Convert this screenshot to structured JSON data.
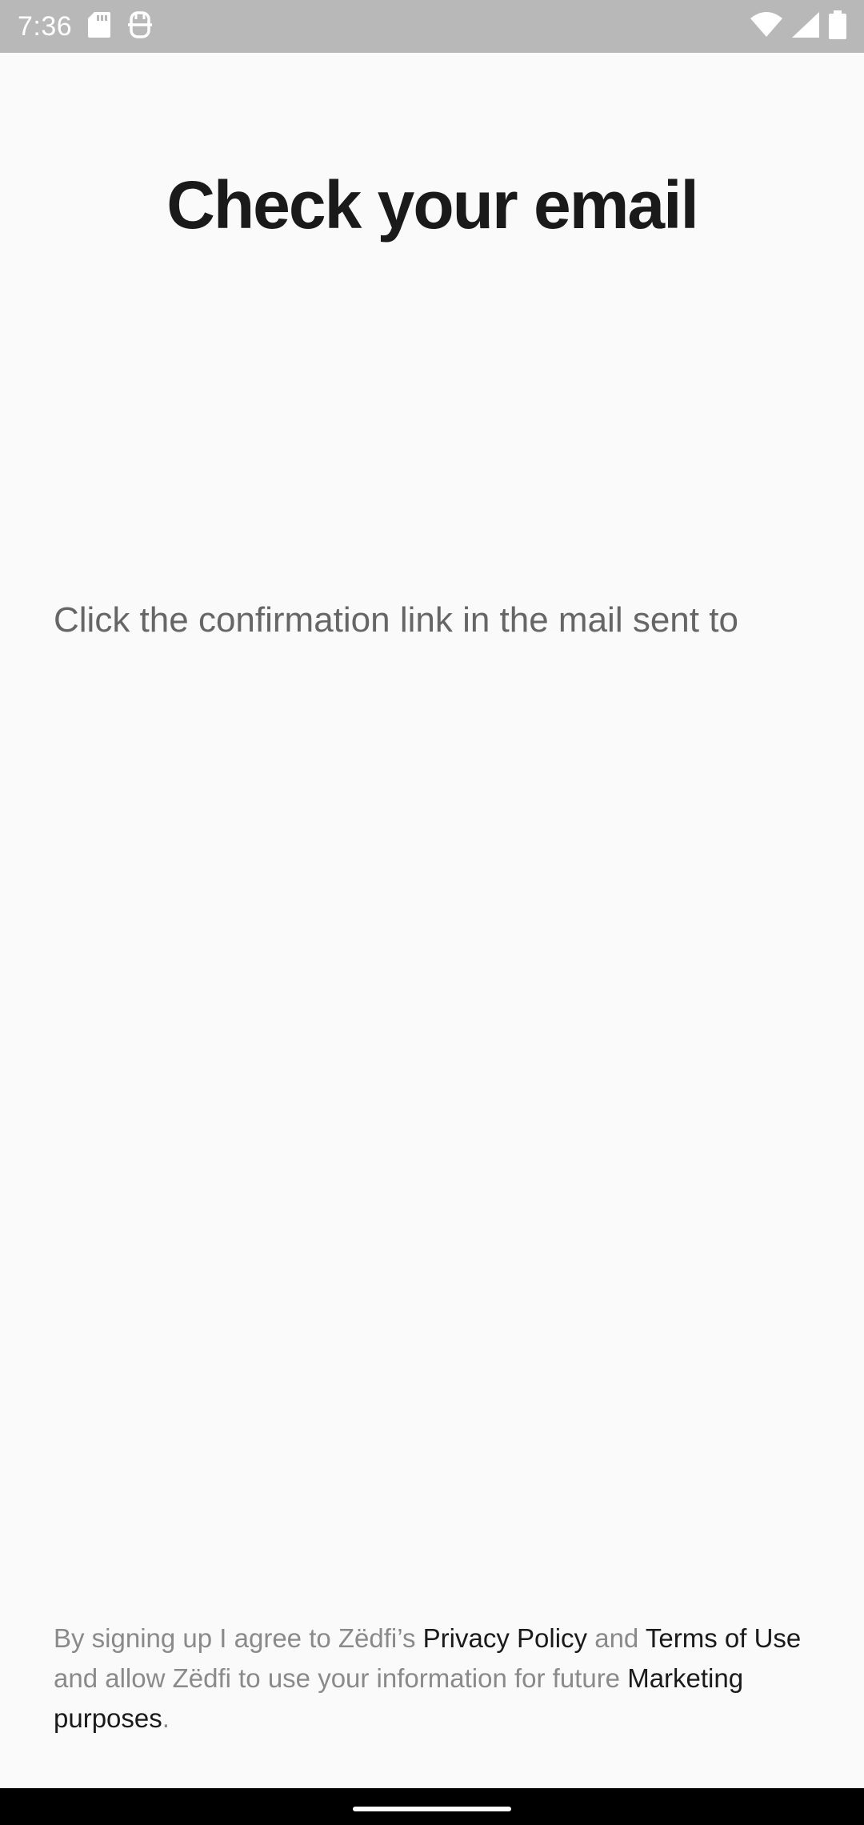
{
  "status_bar": {
    "time": "7:36",
    "left_icons": [
      "sd-card-icon",
      "assistant-icon"
    ],
    "right_icons": [
      "wifi-icon",
      "cellular-signal-icon",
      "battery-icon"
    ],
    "background_color": "#b8b8b8"
  },
  "header": {
    "title": "Check your email"
  },
  "main": {
    "message": "Click the confirmation link in the mail sent to"
  },
  "footer": {
    "legal_prefix": "By signing up I agree to Zëdfi’s ",
    "privacy_link": "Privacy Policy",
    "and_text": " and ",
    "terms_link": "Terms of Use",
    "middle_text": " and allow Zëdfi to use your information for future ",
    "marketing_link": "Marketing purposes",
    "suffix": "."
  },
  "navigation": {
    "home_handle": "home-gesture-handle"
  }
}
